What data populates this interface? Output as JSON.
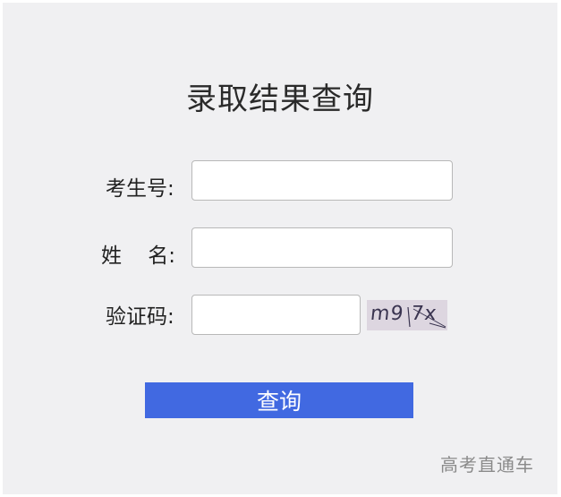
{
  "page": {
    "title": "录取结果查询"
  },
  "form": {
    "exam_number_label": "考生号:",
    "exam_number_value": "",
    "name_label": "姓    名:",
    "name_value": "",
    "captcha_label": "验证码:",
    "captcha_value": "",
    "captcha_image_text": "m9 7x"
  },
  "actions": {
    "submit_label": "查询"
  },
  "watermark": {
    "text": "高考直通车"
  },
  "colors": {
    "panel_background": "#f0f0f2",
    "button_background": "#4169e1",
    "button_text": "#ffffff",
    "captcha_background": "#ddd6e0"
  }
}
